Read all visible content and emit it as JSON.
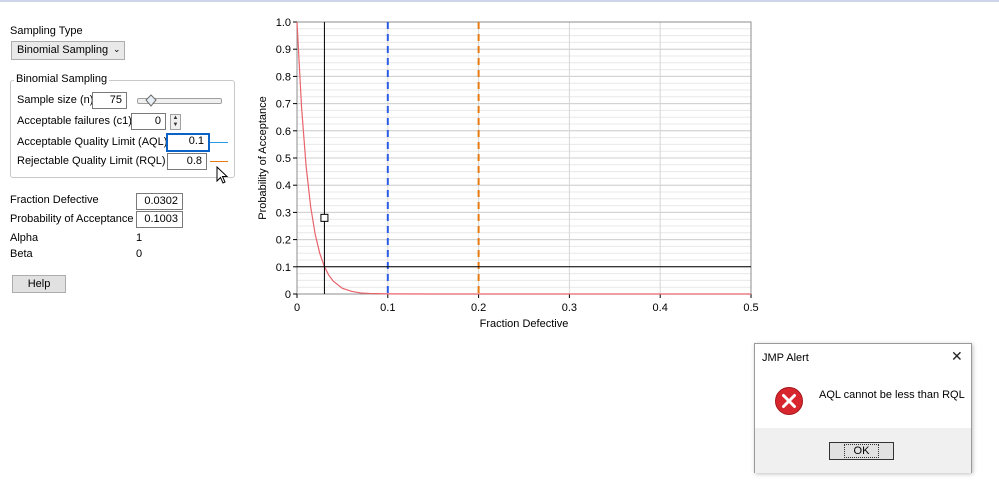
{
  "sampling_type_label": "Sampling Type",
  "sampling_type_value": "Binomial Sampling",
  "group_title": "Binomial Sampling",
  "fields": {
    "sample_size": {
      "label": "Sample size (n)",
      "value": "75"
    },
    "acceptable_failures": {
      "label": "Acceptable failures (c1)",
      "value": "0"
    },
    "aql": {
      "label": "Acceptable Quality Limit (AQL)",
      "value": "0.1"
    },
    "rql": {
      "label": "Rejectable Quality Limit (RQL)",
      "value": "0.8"
    }
  },
  "slider_fraction": 0.16,
  "results": {
    "fraction_defective": {
      "label": "Fraction Defective",
      "value": "0.0302"
    },
    "prob_acceptance": {
      "label": "Probability of Acceptance",
      "value": "0.1003"
    },
    "alpha": {
      "label": "Alpha",
      "value": "1"
    },
    "beta": {
      "label": "Beta",
      "value": "0"
    }
  },
  "help_label": "Help",
  "colors": {
    "aql": "#2b5ce6",
    "rql": "#e87a12",
    "curve": "#e8636b",
    "focus": "#0a64c8"
  },
  "chart_data": {
    "type": "line",
    "xlabel": "Fraction Defective",
    "ylabel": "Probability of Acceptance",
    "xlim": [
      0,
      0.5
    ],
    "ylim": [
      0,
      1
    ],
    "xticks": [
      "0",
      "0.1",
      "0.2",
      "0.3",
      "0.4",
      "0.5"
    ],
    "yticks": [
      "0",
      "0.1",
      "0.2",
      "0.3",
      "0.4",
      "0.5",
      "0.6",
      "0.7",
      "0.8",
      "0.9",
      "1.0"
    ],
    "grid": true,
    "curve": {
      "x": [
        0,
        0.005,
        0.01,
        0.015,
        0.02,
        0.025,
        0.03,
        0.035,
        0.04,
        0.05,
        0.06,
        0.07,
        0.08,
        0.1,
        0.15,
        0.2,
        0.3,
        0.4,
        0.5
      ],
      "y": [
        1,
        0.687,
        0.471,
        0.322,
        0.22,
        0.15,
        0.102,
        0.069,
        0.047,
        0.021,
        0.01,
        0.004,
        0.002,
        0.0004,
        0,
        0,
        0,
        0,
        0
      ]
    },
    "aql_line_x": 0.1,
    "rql_line_x": 0.2,
    "crosshair": {
      "x": 0.0302,
      "y": 0.1003
    },
    "marker": {
      "x": 0.0302,
      "y": 0.28
    }
  },
  "alert": {
    "title": "JMP Alert",
    "close_glyph": "✕",
    "message": "AQL cannot be less than RQL",
    "ok_label": "OK"
  }
}
